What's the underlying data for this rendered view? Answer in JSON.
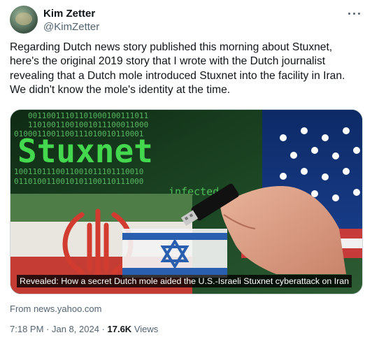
{
  "author": {
    "display_name": "Kim Zetter",
    "handle": "@KimZetter"
  },
  "tweet": {
    "text": "Regarding Dutch news story published this morning about Stuxnet, here's the original 2019 story that I wrote with the Dutch journalist revealing that a Dutch mole introduced Stuxnet into the facility in Iran. We didn't know the mole's identity at the time."
  },
  "card": {
    "image_title_text": "Stuxnet",
    "image_infected_text": "infected",
    "caption": "Revealed: How a secret Dutch mole aided the U.S.-Israeli Stuxnet cyberattack on Iran",
    "source": "From news.yahoo.com"
  },
  "meta": {
    "time": "7:18 PM",
    "separator": " · ",
    "date": "Jan 8, 2024",
    "views_count": "17.6K",
    "views_label": " Views"
  },
  "icons": {
    "more": "more-horizontal-icon"
  }
}
